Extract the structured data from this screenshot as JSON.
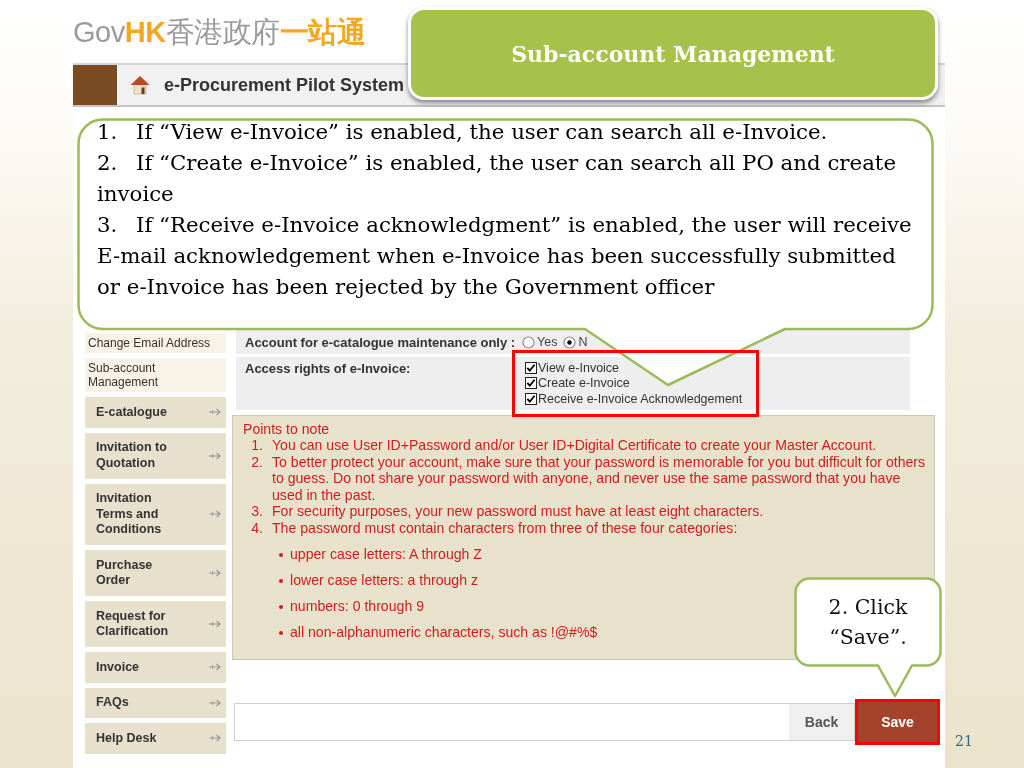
{
  "slide": {
    "title": "Sub-account Management",
    "page_number": "21"
  },
  "logo": [
    {
      "text": "Gov",
      "kind": "plain"
    },
    {
      "text": "HK",
      "kind": "accent"
    },
    {
      "text": "香港政府",
      "kind": "plain"
    },
    {
      "text": "一站通",
      "kind": "accent"
    }
  ],
  "header": {
    "title": "e-Procurement Pilot System"
  },
  "sidebar": {
    "items": [
      {
        "label": "Change Email Address",
        "kind": "sub"
      },
      {
        "label": "Sub-account Management",
        "kind": "sub"
      },
      {
        "label": "E-catalogue",
        "kind": "main"
      },
      {
        "label": "Invitation to Quotation",
        "kind": "main"
      },
      {
        "label": "Invitation Terms and Conditions",
        "kind": "main"
      },
      {
        "label": "Purchase Order",
        "kind": "main"
      },
      {
        "label": "Request for Clarification",
        "kind": "main"
      },
      {
        "label": "Invoice",
        "kind": "main"
      },
      {
        "label": "FAQs",
        "kind": "main"
      },
      {
        "label": "Help Desk",
        "kind": "main"
      }
    ]
  },
  "form": {
    "rows": [
      {
        "label": "Account for e-catalogue maintenance only :",
        "kind": "radio",
        "highlighted": false,
        "options": [
          {
            "label": "Yes",
            "selected": false
          },
          {
            "label": "N",
            "selected": true
          }
        ]
      },
      {
        "label": "Access rights of e-Invoice:",
        "kind": "checkbox",
        "highlighted": true,
        "options": [
          {
            "label": "View e-Invoice",
            "checked": true
          },
          {
            "label": "Create e-Invoice",
            "checked": true
          },
          {
            "label": "Receive e-Invoice Acknowledgement",
            "checked": true
          }
        ]
      }
    ]
  },
  "notes": {
    "title": "Points to note",
    "items": [
      {
        "number": "1.",
        "text": "You can use User ID+Password and/or User ID+Digital Certificate to create your Master Account."
      },
      {
        "number": "2.",
        "text": "To better protect your account, make sure that your password is memorable for you but difficult for others to guess. Do not share your password with anyone, and never use the same password that you have used in the past."
      },
      {
        "number": "3.",
        "text": "For security purposes, your new password must have at least eight characters."
      },
      {
        "number": "4.",
        "text": "The password must contain characters from three of these four categories:",
        "children": [
          {
            "text": "upper case letters: A through Z"
          },
          {
            "text": "lower case letters: a through z"
          },
          {
            "text": "numbers: 0 through 9"
          },
          {
            "text": "all non-alphanumeric characters, such as !@#%$"
          }
        ]
      }
    ]
  },
  "buttons": [
    {
      "label": "Back",
      "kind": "secondary",
      "highlighted": false
    },
    {
      "label": "Save",
      "kind": "primary",
      "highlighted": true
    }
  ],
  "callouts": [
    {
      "kind": "steps",
      "items": [
        {
          "number": "1.",
          "text": "If “View e-Invoice” is enabled, the user can search all e-Invoice."
        },
        {
          "number": "2.",
          "text": "If “Create e-Invoice” is enabled, the user can search all PO and create invoice"
        },
        {
          "number": "3.",
          "text": "If “Receive e-Invoice acknowledgment” is enabled, the user will receive E-mail acknowledgement when e-Invoice has been successfully submitted or e-Invoice has been rejected by the Government officer"
        }
      ]
    },
    {
      "kind": "note",
      "text": "2. Click “Save”."
    }
  ]
}
